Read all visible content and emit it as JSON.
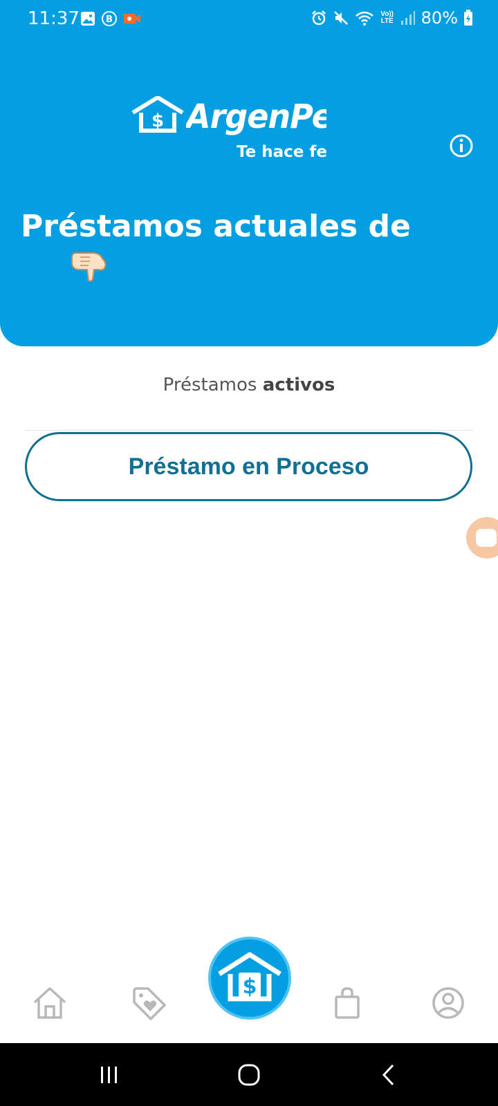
{
  "status_bar": {
    "time": "11:37",
    "battery": "80%",
    "network_label": "Vo)) LTE",
    "icons_left": [
      "gallery-icon",
      "b-badge-icon",
      "video-record-icon"
    ],
    "icons_right": [
      "alarm-icon",
      "mute-icon",
      "wifi-icon",
      "lte-icon",
      "signal-icon",
      "battery-icon"
    ]
  },
  "brand": {
    "name": "ArgenPe$os",
    "tagline": "Te hace feliz",
    "color": "#049fe2"
  },
  "header": {
    "title": "Préstamos actuales de",
    "emoji": "👇"
  },
  "section": {
    "label_prefix": "Préstamos ",
    "label_bold": "activos"
  },
  "loan_button": {
    "label": "Préstamo en Proceso"
  },
  "bottom_nav": {
    "items": [
      "home-icon",
      "tag-heart-icon",
      "house-dollar-icon",
      "shopping-bag-icon",
      "account-icon"
    ]
  },
  "colors": {
    "header_bg": "#049fe2",
    "button_border": "#0f6e91",
    "button_text": "#126f94",
    "bubble": "#f8c8a4"
  }
}
